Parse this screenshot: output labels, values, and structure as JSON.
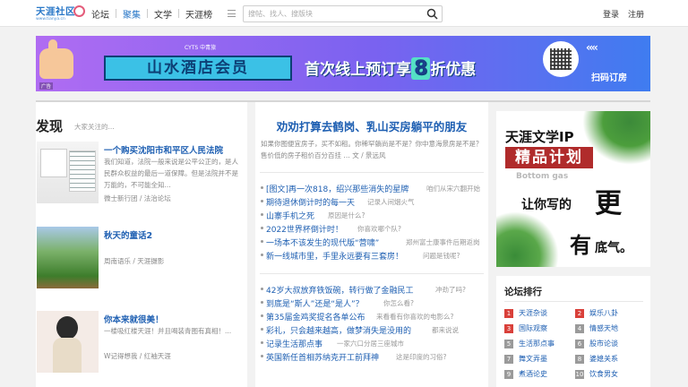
{
  "header": {
    "logo": {
      "text": "天涯社区",
      "url": "www.tianya.cn"
    },
    "nav": [
      "论坛",
      "聚集",
      "文学",
      "天涯榜"
    ],
    "search_placeholder": "搜帖、找人、搜版块",
    "login": "登录",
    "register": "注册"
  },
  "banner": {
    "brand": "CYTS 中青旅",
    "text_a": "山水酒店会员",
    "text_b_prefix": "首次线上预订享",
    "text_b_number": "8",
    "text_b_suffix": "折优惠",
    "arrows": "‹‹‹‹",
    "scan": "扫码订房",
    "ad_tag": "广告"
  },
  "discover": {
    "title": "发现",
    "subtitle": "大家关注的...",
    "items": [
      {
        "title": "一个购买沈阳市和平区人民法院",
        "desc": "我们知道，法院一般来说是公平公正的，是人民群众权益的最后一道保障。但是法院并不是万能的，不可能全知...",
        "meta": "微士新行团 / 法治论坛"
      },
      {
        "title": "秋天的童话2",
        "desc": "",
        "meta": "周南语乐 / 天涯摄影"
      },
      {
        "title": "你本来就很美！",
        "desc": "一楼吸红楼天涯！并且喝装青图有真相！...",
        "meta": "W记得想我 / 红袖天涯"
      }
    ]
  },
  "middle": {
    "featured_title": "劝劝打算去鹤岗、乳山买房躺平的朋友",
    "featured_desc": "如果你图便宜房子，买不如租。你稀罕躺尚是不是？你中意海景房是不是？售价低的房子租价百分百挂 … 文 / 景远风",
    "group1": [
      {
        "t": "[图文]再一次818，绍兴那些消失的星牌",
        "s": "咱们从宋六翻开始"
      },
      {
        "t": "期待退休倒计时的每一天",
        "s": "记录人间烟火气"
      },
      {
        "t": "山寨手机之死",
        "s": "原因是什么?"
      },
      {
        "t": "2022世界杯倒计时！",
        "s": "你喜欢哪个队?"
      },
      {
        "t": "一场本不该发生的现代版“营啸”",
        "s": "郑州富士康事件后期返岗"
      },
      {
        "t": "新一线城市里，手里永远要有三套房！",
        "s": "问题是钱呢?"
      }
    ],
    "group2": [
      {
        "t": "42岁大叔放弃铁饭碗，转行做了金融民工",
        "s": "冲劲了吗?"
      },
      {
        "t": "到底是“斯人”还是“是人”？",
        "s": "你怎么看?"
      },
      {
        "t": "第35届金鸡奖提名各单公布",
        "s": "来看看有你喜欢的电影么?"
      },
      {
        "t": "彩礼，只会越来越高，做梦消失是没用的",
        "s": "都来说说"
      },
      {
        "t": "记录生活那点事",
        "s": "一家六口分居三座城市"
      },
      {
        "t": "英国新任首相苏纳克开工前拜神",
        "s": "这是印度的习俗?"
      }
    ]
  },
  "right": {
    "ip_ad": {
      "line1": "天涯文学IP",
      "line2": "精品计划",
      "line3": "Bottom gas",
      "line4": "让你写的",
      "geng": "更",
      "you": "有",
      "diqi": "底气。"
    },
    "ranking": {
      "title": "论坛排行",
      "items": [
        {
          "rank": "1",
          "name": "天涯杂谈"
        },
        {
          "rank": "2",
          "name": "娱乐八卦"
        },
        {
          "rank": "3",
          "name": "国际观察"
        },
        {
          "rank": "4",
          "name": "情感天地"
        },
        {
          "rank": "5",
          "name": "生活那点事"
        },
        {
          "rank": "6",
          "name": "股市论谈"
        },
        {
          "rank": "7",
          "name": "舞文弄墨"
        },
        {
          "rank": "8",
          "name": "婆媳关系"
        },
        {
          "rank": "9",
          "name": "煮酒论史"
        },
        {
          "rank": "10",
          "name": "饮食男女"
        }
      ]
    }
  },
  "colors": {
    "link": "#1e5fb2",
    "accent": "#2a78c8",
    "rank_top": "#d9403a",
    "rank_rest": "#9a9a9a"
  }
}
